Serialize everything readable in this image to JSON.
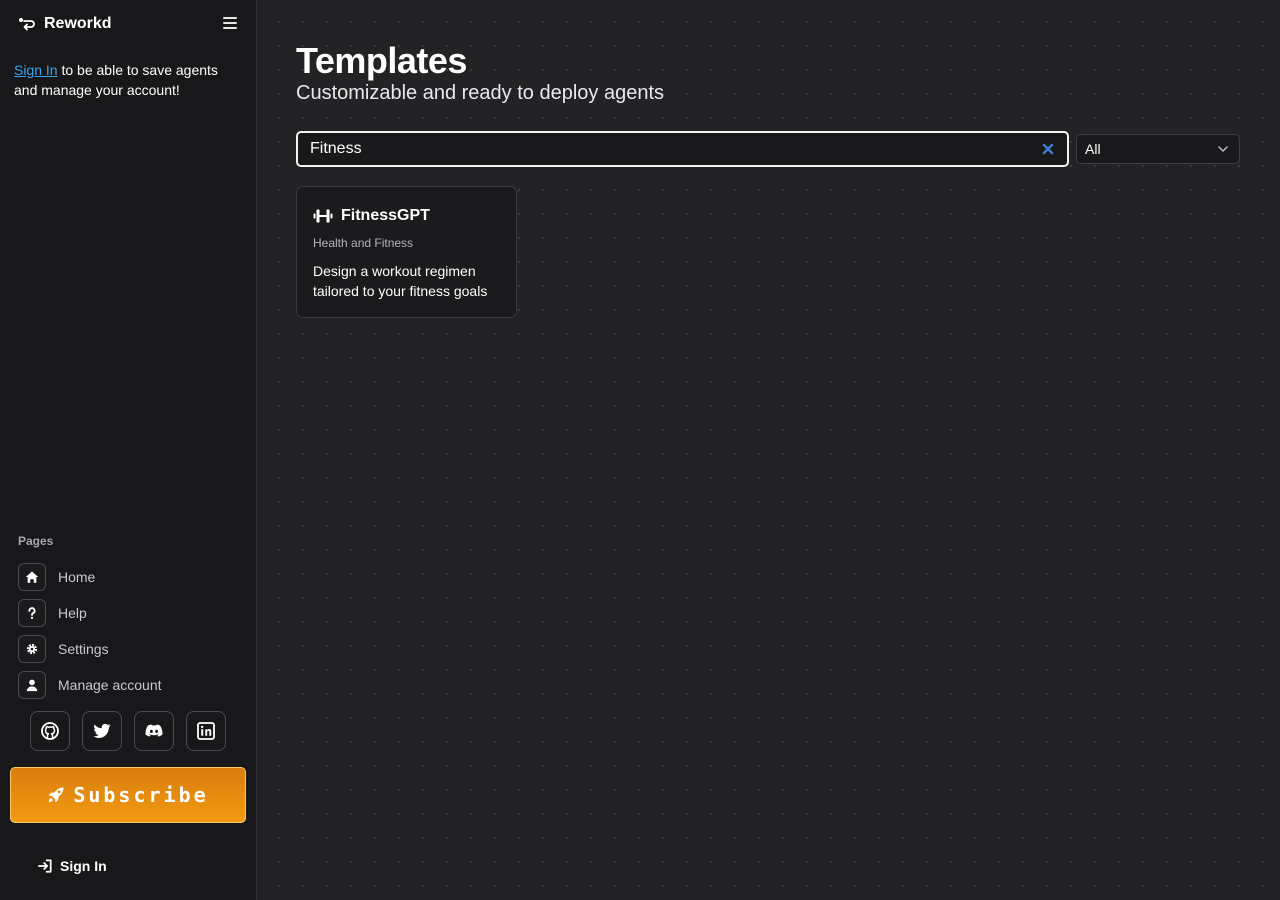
{
  "app": {
    "brand": "Reworkd"
  },
  "sidebar": {
    "signin_link": "Sign In",
    "signin_note": "to be able to save agents and manage your account!",
    "pages_heading": "Pages",
    "items": [
      {
        "label": "Home",
        "icon": "home-icon"
      },
      {
        "label": "Help",
        "icon": "question-icon"
      },
      {
        "label": "Settings",
        "icon": "gear-icon"
      },
      {
        "label": "Manage account",
        "icon": "user-icon"
      }
    ],
    "socials": [
      "github-icon",
      "twitter-icon",
      "discord-icon",
      "linkedin-icon"
    ],
    "subscribe_label": "Subscribe",
    "signin_button": "Sign In"
  },
  "main": {
    "title": "Templates",
    "subtitle": "Customizable and ready to deploy agents",
    "search": {
      "value": "Fitness",
      "placeholder": ""
    },
    "filter": {
      "selected": "All"
    },
    "cards": [
      {
        "name": "FitnessGPT",
        "icon": "dumbbell-icon",
        "category": "Health and Fitness",
        "description": "Design a workout regimen tailored to your fitness goals"
      }
    ]
  },
  "colors": {
    "accent_link": "#3aa3ef",
    "subscribe_orange": "#f29a12",
    "background": "#232325",
    "sidebar": "#18181a"
  }
}
